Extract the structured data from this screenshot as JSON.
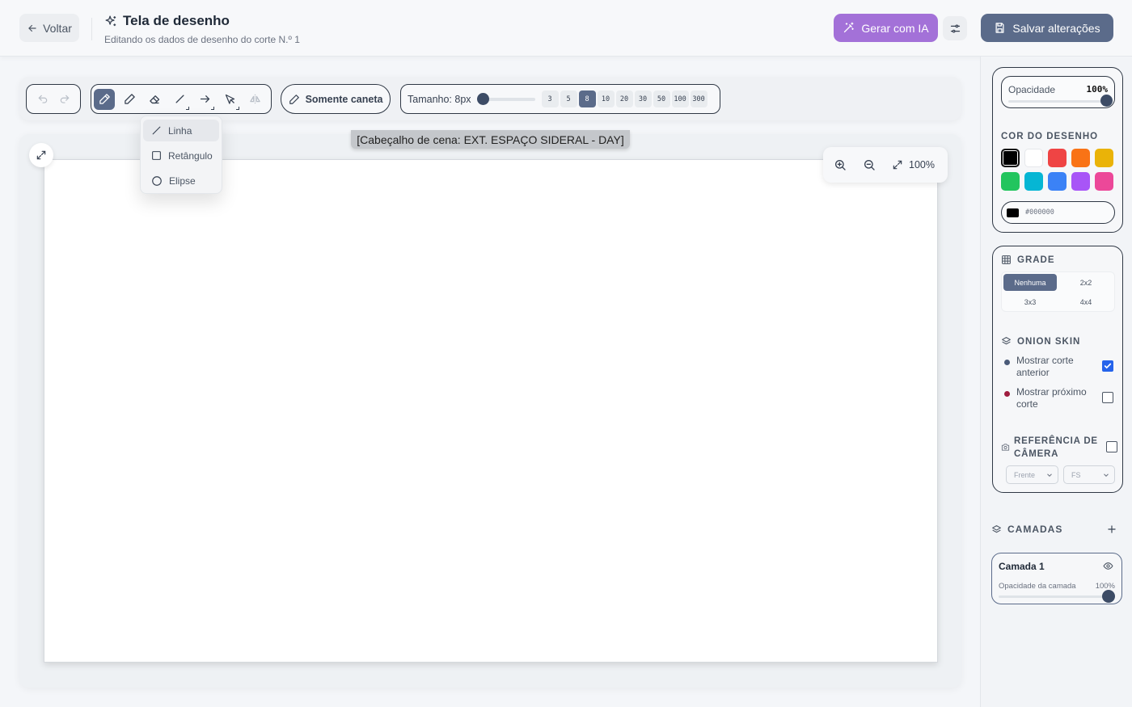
{
  "header": {
    "back_label": "Voltar",
    "title": "Tela de desenho",
    "subtitle": "Editando os dados de desenho do corte N.º 1",
    "ai_button": "Gerar com IA",
    "save_button": "Salvar alterações"
  },
  "toolbar": {
    "pen_only_label": "Somente caneta",
    "size_label": "Tamanho: 8px",
    "size_value": 8,
    "size_options": [
      "3",
      "5",
      "8",
      "10",
      "20",
      "30",
      "50",
      "100",
      "300"
    ],
    "active_size": "8"
  },
  "shape_menu": {
    "items": [
      "Linha",
      "Retângulo",
      "Elipse"
    ],
    "active": "Linha"
  },
  "canvas": {
    "scene_header": "[Cabeçalho de cena: EXT. ESPAÇO SIDERAL - DAY]",
    "zoom": "100%"
  },
  "panel": {
    "opacity_label": "Opacidade",
    "opacity_value": "100%",
    "color_title": "COR DO DESENHO",
    "colors": [
      "#000000",
      "#ffffff",
      "#ef4444",
      "#f97316",
      "#eab308",
      "#22c55e",
      "#06b6d4",
      "#3b82f6",
      "#a855f7",
      "#ec4899"
    ],
    "selected_color": "#000000",
    "hex_value": "#000000",
    "grid_title": "GRADE",
    "grid_options": [
      "Nenhuma",
      "2x2",
      "3x3",
      "4x4"
    ],
    "grid_active": "Nenhuma",
    "onion_title": "ONION SKIN",
    "onion_prev": "Mostrar corte anterior",
    "onion_prev_checked": true,
    "onion_next": "Mostrar próximo corte",
    "onion_next_checked": false,
    "onion_prev_color": "#4a5a78",
    "onion_next_color": "#9f1d3f",
    "camera_title": "REFERÊNCIA DE CÂMERA",
    "camera_checked": false,
    "camera_view": "Frente",
    "camera_shot": "FS"
  },
  "layers": {
    "title": "CAMADAS",
    "items": [
      {
        "name": "Camada 1",
        "opacity_label": "Opacidade da camada",
        "opacity_value": "100%"
      }
    ]
  }
}
